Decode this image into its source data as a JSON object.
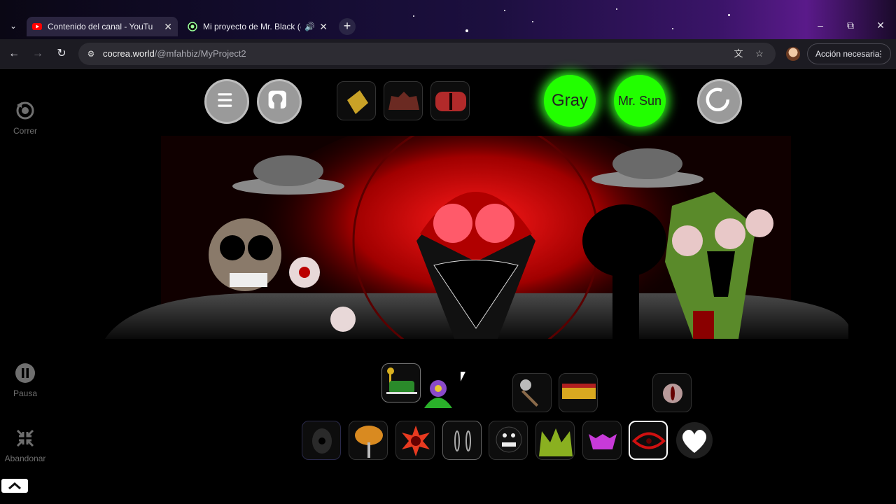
{
  "browser": {
    "tabs": [
      {
        "title": "Contenido del canal - YouTube",
        "active": true,
        "favicon": "youtube-icon"
      },
      {
        "title": "Mi proyecto de Mr. Black (@",
        "active": false,
        "favicon": "cocrea-icon",
        "audio": true
      }
    ],
    "url_host": "cocrea.world",
    "url_path": "/@mfahbiz/MyProject2",
    "action_label": "Acción necesaria",
    "colors": {
      "tab_bg": "#2b2540",
      "toolbar_bg": "#1c1b22",
      "omnibox_bg": "#2d2c33"
    }
  },
  "sidebar": {
    "restart_label": "Correr",
    "pause_label": "Pausa",
    "exit_label": "Abandonar"
  },
  "controls": {
    "mode_buttons": [
      {
        "label": "Gray",
        "color": "#22ff00"
      },
      {
        "label": "Mr. Sun",
        "color": "#22ff00"
      }
    ]
  },
  "icons": [
    "menu-icon",
    "portrait-icon",
    "reset-icon",
    "heart-icon",
    "replay-icon",
    "pause-icon",
    "compress-icon",
    "chevron-up-icon"
  ]
}
